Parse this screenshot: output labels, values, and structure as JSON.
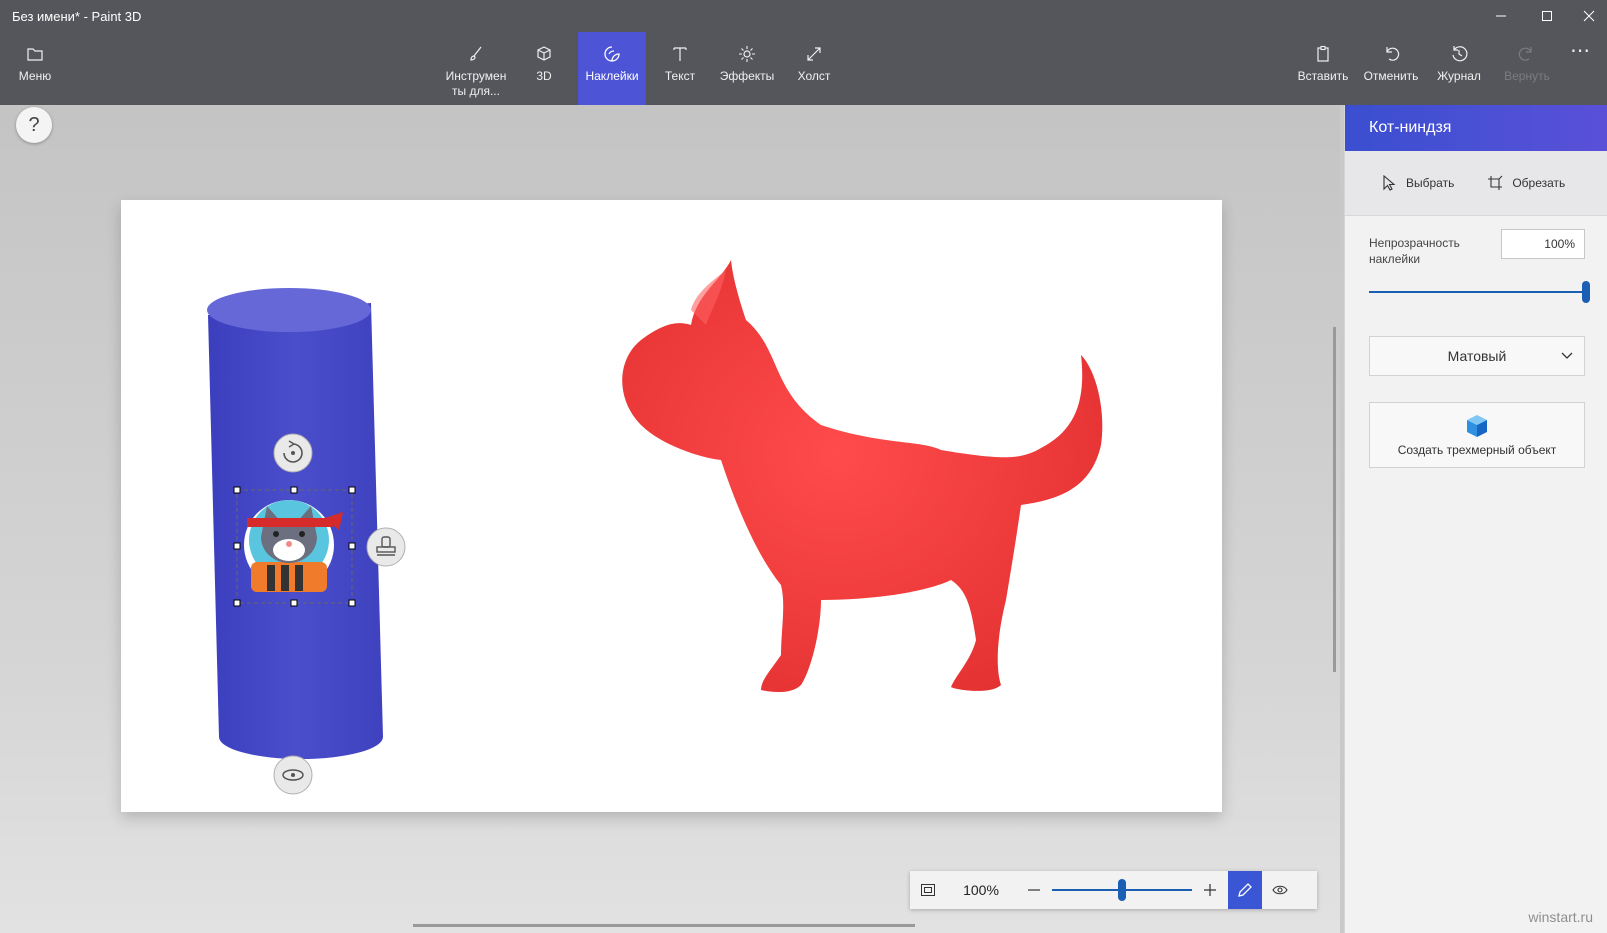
{
  "window": {
    "title": "Без имени* - Paint 3D"
  },
  "toolbar": {
    "menu": {
      "label": "Меню",
      "icon": "folder-icon"
    },
    "tools": [
      {
        "label": "Инструмен ты для...",
        "icon": "brush-icon"
      },
      {
        "label": "3D",
        "icon": "cube-icon"
      },
      {
        "label": "Наклейки",
        "icon": "sticker-icon",
        "active": true
      },
      {
        "label": "Текст",
        "icon": "text-icon"
      },
      {
        "label": "Эффекты",
        "icon": "effects-icon"
      },
      {
        "label": "Холст",
        "icon": "canvas-icon"
      }
    ],
    "actions": [
      {
        "label": "Вставить",
        "icon": "paste-icon"
      },
      {
        "label": "Отменить",
        "icon": "undo-icon"
      },
      {
        "label": "Журнал",
        "icon": "history-icon"
      },
      {
        "label": "Вернуть",
        "icon": "redo-icon",
        "disabled": true
      }
    ],
    "more": "⋯"
  },
  "help": {
    "label": "?"
  },
  "zoom": {
    "value": "100%",
    "slider_fraction": 0.5
  },
  "panel": {
    "title": "Кот-ниндзя",
    "select_label": "Выбрать",
    "crop_label": "Обрезать",
    "opacity_label": "Непрозрачность наклейки",
    "opacity_value": "100%",
    "opacity_fraction": 1.0,
    "finish_selected": "Матовый",
    "make3d_label": "Создать трехмерный объект"
  },
  "watermark": "winstart.ru",
  "colors": {
    "toolbar_bg": "#55565b",
    "accent": "#4d55d6",
    "cylinder": "#4548c6",
    "cat": "#ee3b3b"
  }
}
